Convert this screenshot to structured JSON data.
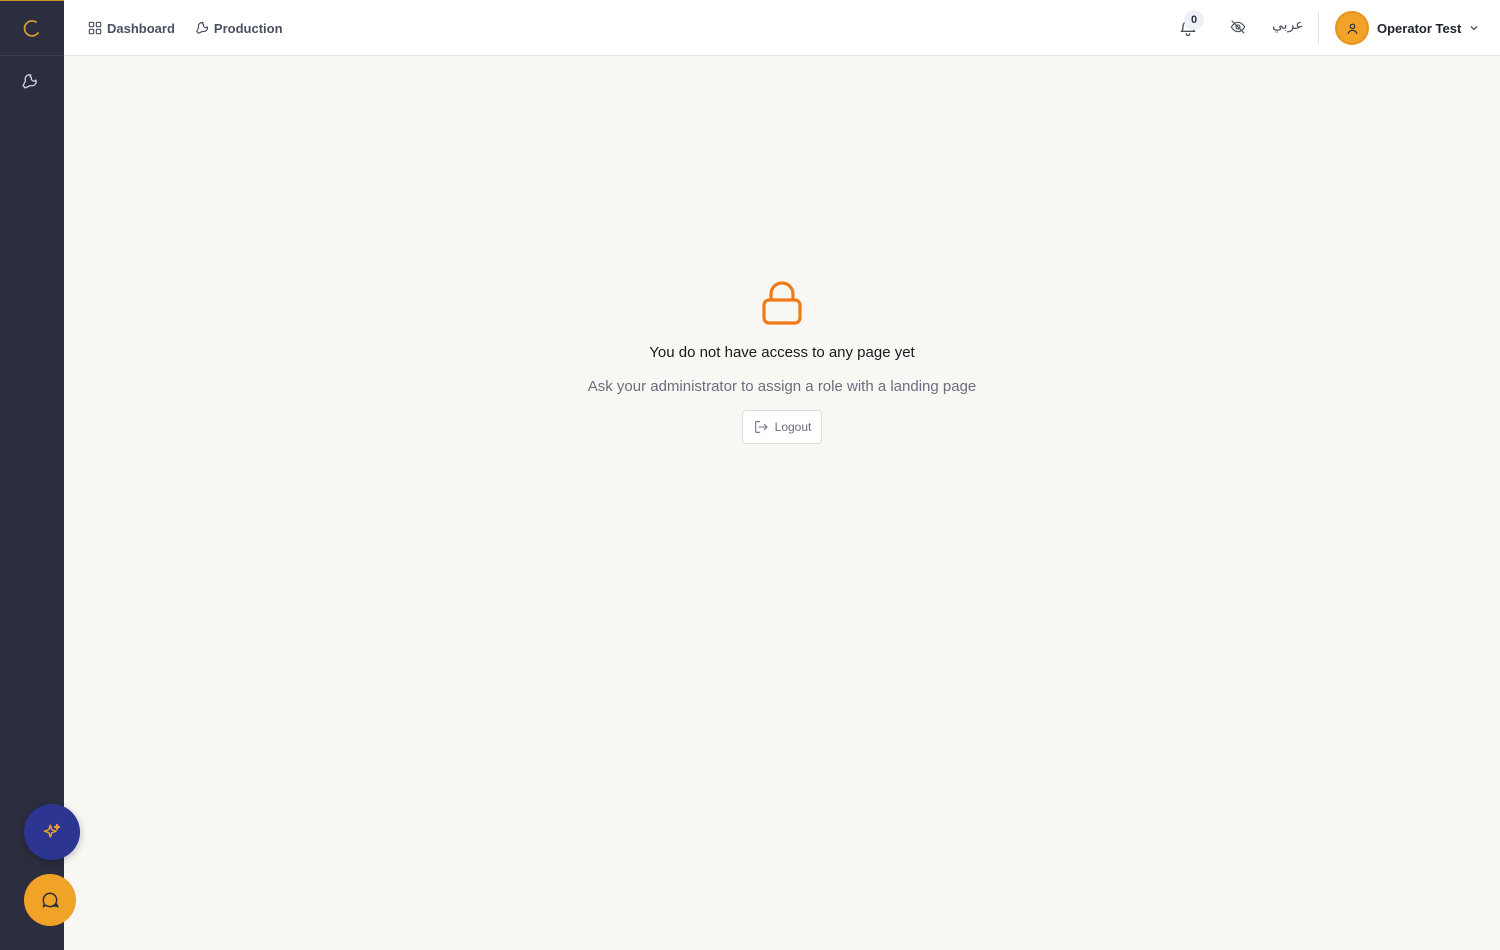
{
  "sidebar": {
    "logo_icon": "loading-arc-logo",
    "items": [
      {
        "icon": "wrench-icon"
      }
    ]
  },
  "topbar": {
    "nav": [
      {
        "label": "Dashboard",
        "icon": "grid-icon"
      },
      {
        "label": "Production",
        "icon": "wrench-icon"
      }
    ],
    "notifications_count": "0",
    "language_label": "عربي",
    "user_name": "Operator Test"
  },
  "main": {
    "title": "You do not have access to any page yet",
    "subtitle": "Ask your administrator to assign a role with a landing page",
    "logout_label": "Logout"
  },
  "colors": {
    "sidebar_bg": "#2b2e3f",
    "accent_orange": "#f07a1a",
    "avatar_bg": "#f0a326",
    "ai_fab_bg": "#2d3592"
  }
}
